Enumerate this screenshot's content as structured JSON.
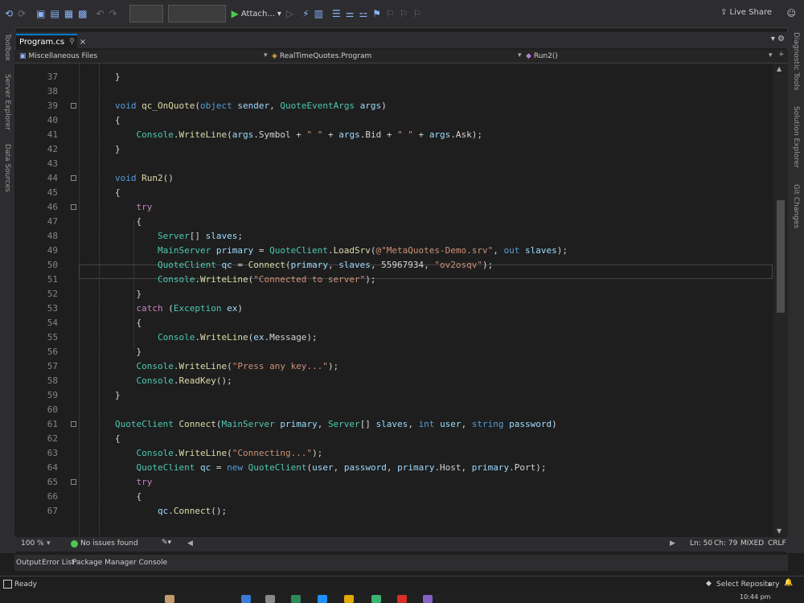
{
  "toolbar": {
    "attach_label": "Attach...",
    "live_share": "Live Share"
  },
  "rails": {
    "left": [
      "Toolbox",
      "Server Explorer",
      "Data Sources"
    ],
    "right": [
      "Diagnostic Tools",
      "Solution Explorer",
      "Git Changes"
    ]
  },
  "tab": {
    "label": "Program.cs",
    "pin": "⚲",
    "close": "×"
  },
  "tabbar_right": "▾ ⚙",
  "navbar": {
    "project": "Miscellaneous Files",
    "class": "RealTimeQuotes.Program",
    "member": "Run2()"
  },
  "code": {
    "lines": [
      {
        "n": "37",
        "segs": [
          [
            "pl",
            "}"
          ]
        ]
      },
      {
        "n": "38",
        "segs": []
      },
      {
        "n": "39",
        "segs": [
          [
            "kw",
            "void "
          ],
          [
            "fn",
            "qc_OnQuote"
          ],
          [
            "pl",
            "("
          ],
          [
            "kw",
            "object "
          ],
          [
            "pa",
            "sender"
          ],
          [
            "pl",
            ", "
          ],
          [
            "ty",
            "QuoteEventArgs "
          ],
          [
            "pa",
            "args"
          ],
          [
            "pl",
            ")"
          ]
        ]
      },
      {
        "n": "40",
        "segs": [
          [
            "pl",
            "{"
          ]
        ]
      },
      {
        "n": "41",
        "segs": [
          [
            "pl",
            "    "
          ],
          [
            "ty",
            "Console"
          ],
          [
            "pl",
            "."
          ],
          [
            "fn",
            "WriteLine"
          ],
          [
            "pl",
            "("
          ],
          [
            "pa",
            "args"
          ],
          [
            "pl",
            ".Symbol + "
          ],
          [
            "str",
            "\" \""
          ],
          [
            "pl",
            " + "
          ],
          [
            "pa",
            "args"
          ],
          [
            "pl",
            ".Bid + "
          ],
          [
            "str",
            "\" \""
          ],
          [
            "pl",
            " + "
          ],
          [
            "pa",
            "args"
          ],
          [
            "pl",
            ".Ask);"
          ]
        ]
      },
      {
        "n": "42",
        "segs": [
          [
            "pl",
            "}"
          ]
        ]
      },
      {
        "n": "43",
        "segs": []
      },
      {
        "n": "44",
        "segs": [
          [
            "kw",
            "void "
          ],
          [
            "fn",
            "Run2"
          ],
          [
            "pl",
            "()"
          ]
        ]
      },
      {
        "n": "45",
        "segs": [
          [
            "pl",
            "{"
          ]
        ]
      },
      {
        "n": "46",
        "segs": [
          [
            "pl",
            "    "
          ],
          [
            "ct",
            "try"
          ]
        ]
      },
      {
        "n": "47",
        "segs": [
          [
            "pl",
            "    {"
          ]
        ]
      },
      {
        "n": "48",
        "segs": [
          [
            "pl",
            "        "
          ],
          [
            "ty",
            "Server"
          ],
          [
            "pl",
            "[] "
          ],
          [
            "pa",
            "slaves"
          ],
          [
            "pl",
            ";"
          ]
        ]
      },
      {
        "n": "49",
        "segs": [
          [
            "pl",
            "        "
          ],
          [
            "ty",
            "MainServer "
          ],
          [
            "pa",
            "primary"
          ],
          [
            "pl",
            " = "
          ],
          [
            "ty",
            "QuoteClient"
          ],
          [
            "pl",
            "."
          ],
          [
            "fn",
            "LoadSrv"
          ],
          [
            "pl",
            "("
          ],
          [
            "str",
            "@\"MetaQuotes-Demo.srv\""
          ],
          [
            "pl",
            ", "
          ],
          [
            "kw",
            "out "
          ],
          [
            "pa",
            "slaves"
          ],
          [
            "pl",
            ");"
          ]
        ]
      },
      {
        "n": "50",
        "segs": [
          [
            "pl",
            "        "
          ],
          [
            "ty",
            "QuoteClient "
          ],
          [
            "pa",
            "qc"
          ],
          [
            "pl",
            " = "
          ],
          [
            "fn",
            "Connect"
          ],
          [
            "pl",
            "("
          ],
          [
            "pa",
            "primary"
          ],
          [
            "pl",
            ", "
          ],
          [
            "pa",
            "slaves"
          ],
          [
            "pl",
            ", 55967934, "
          ],
          [
            "str",
            "\"ov2osqv\""
          ],
          [
            "pl",
            ");"
          ]
        ]
      },
      {
        "n": "51",
        "segs": [
          [
            "pl",
            "        "
          ],
          [
            "ty",
            "Console"
          ],
          [
            "pl",
            "."
          ],
          [
            "fn",
            "WriteLine"
          ],
          [
            "pl",
            "("
          ],
          [
            "str",
            "\"Connected to server\""
          ],
          [
            "pl",
            ");"
          ]
        ]
      },
      {
        "n": "52",
        "segs": [
          [
            "pl",
            "    }"
          ]
        ]
      },
      {
        "n": "53",
        "segs": [
          [
            "pl",
            "    "
          ],
          [
            "ct",
            "catch "
          ],
          [
            "pl",
            "("
          ],
          [
            "ty",
            "Exception "
          ],
          [
            "pa",
            "ex"
          ],
          [
            "pl",
            ")"
          ]
        ]
      },
      {
        "n": "54",
        "segs": [
          [
            "pl",
            "    {"
          ]
        ]
      },
      {
        "n": "55",
        "segs": [
          [
            "pl",
            "        "
          ],
          [
            "ty",
            "Console"
          ],
          [
            "pl",
            "."
          ],
          [
            "fn",
            "WriteLine"
          ],
          [
            "pl",
            "("
          ],
          [
            "pa",
            "ex"
          ],
          [
            "pl",
            ".Message);"
          ]
        ]
      },
      {
        "n": "56",
        "segs": [
          [
            "pl",
            "    }"
          ]
        ]
      },
      {
        "n": "57",
        "segs": [
          [
            "pl",
            "    "
          ],
          [
            "ty",
            "Console"
          ],
          [
            "pl",
            "."
          ],
          [
            "fn",
            "WriteLine"
          ],
          [
            "pl",
            "("
          ],
          [
            "str",
            "\"Press any key...\""
          ],
          [
            "pl",
            ");"
          ]
        ]
      },
      {
        "n": "58",
        "segs": [
          [
            "pl",
            "    "
          ],
          [
            "ty",
            "Console"
          ],
          [
            "pl",
            "."
          ],
          [
            "fn",
            "ReadKey"
          ],
          [
            "pl",
            "();"
          ]
        ]
      },
      {
        "n": "59",
        "segs": [
          [
            "pl",
            "}"
          ]
        ]
      },
      {
        "n": "60",
        "segs": []
      },
      {
        "n": "61",
        "segs": [
          [
            "ty",
            "QuoteClient "
          ],
          [
            "fn",
            "Connect"
          ],
          [
            "pl",
            "("
          ],
          [
            "ty",
            "MainServer "
          ],
          [
            "pa",
            "primary"
          ],
          [
            "pl",
            ", "
          ],
          [
            "ty",
            "Server"
          ],
          [
            "pl",
            "[] "
          ],
          [
            "pa",
            "slaves"
          ],
          [
            "pl",
            ", "
          ],
          [
            "kw",
            "int "
          ],
          [
            "pa",
            "user"
          ],
          [
            "pl",
            ", "
          ],
          [
            "kw",
            "string "
          ],
          [
            "pa",
            "password"
          ],
          [
            "pl",
            ")"
          ]
        ]
      },
      {
        "n": "62",
        "segs": [
          [
            "pl",
            "{"
          ]
        ]
      },
      {
        "n": "63",
        "segs": [
          [
            "pl",
            "    "
          ],
          [
            "ty",
            "Console"
          ],
          [
            "pl",
            "."
          ],
          [
            "fn",
            "WriteLine"
          ],
          [
            "pl",
            "("
          ],
          [
            "str",
            "\"Connecting...\""
          ],
          [
            "pl",
            ");"
          ]
        ]
      },
      {
        "n": "64",
        "segs": [
          [
            "pl",
            "    "
          ],
          [
            "ty",
            "QuoteClient "
          ],
          [
            "pa",
            "qc"
          ],
          [
            "pl",
            " = "
          ],
          [
            "kw",
            "new "
          ],
          [
            "ty",
            "QuoteClient"
          ],
          [
            "pl",
            "("
          ],
          [
            "pa",
            "user"
          ],
          [
            "pl",
            ", "
          ],
          [
            "pa",
            "password"
          ],
          [
            "pl",
            ", "
          ],
          [
            "pa",
            "primary"
          ],
          [
            "pl",
            ".Host, "
          ],
          [
            "pa",
            "primary"
          ],
          [
            "pl",
            ".Port);"
          ]
        ]
      },
      {
        "n": "65",
        "segs": [
          [
            "pl",
            "    "
          ],
          [
            "ct",
            "try"
          ]
        ]
      },
      {
        "n": "66",
        "segs": [
          [
            "pl",
            "    {"
          ]
        ]
      },
      {
        "n": "67",
        "segs": [
          [
            "pl",
            "        "
          ],
          [
            "pa",
            "qc"
          ],
          [
            "pl",
            "."
          ],
          [
            "fn",
            "Connect"
          ],
          [
            "pl",
            "();"
          ]
        ]
      }
    ]
  },
  "editor_status": {
    "zoom": "100 %",
    "issues": "No issues found",
    "ln": "Ln: 50",
    "ch": "Ch: 79",
    "mixed": "MIXED",
    "crlf": "CRLF"
  },
  "bottom_tabs": [
    "Output",
    "Error List",
    "Package Manager Console"
  ],
  "status": {
    "ready": "Ready",
    "repo": "Select Repository",
    "time": "10:44 pm"
  }
}
